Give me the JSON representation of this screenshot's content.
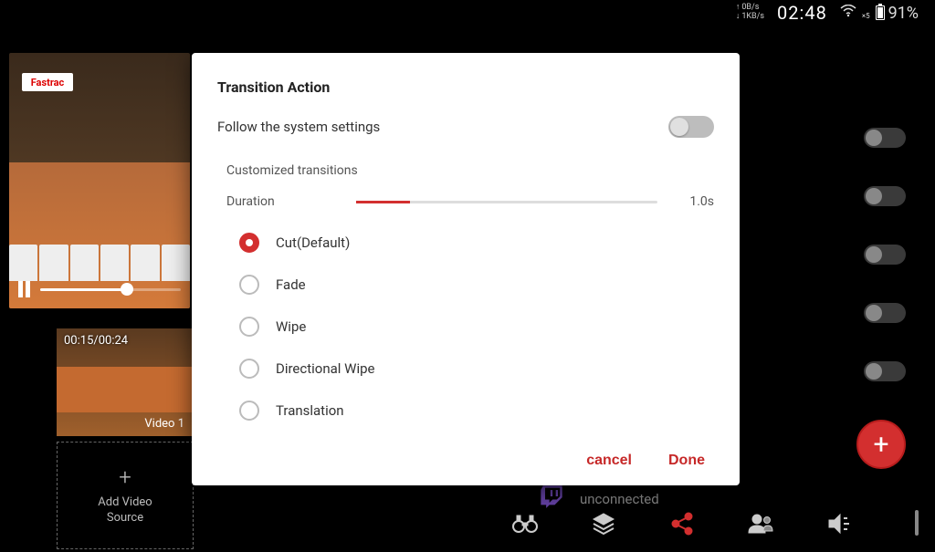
{
  "status": {
    "net_up": "0B/s",
    "net_down": "1KB/s",
    "time": "02:48",
    "wifi_sub": "×5",
    "battery_pct": "91%"
  },
  "preview": {
    "banner": "Fastrac",
    "progress_percent": 62
  },
  "sources": {
    "thumb_time": "00:15/00:24",
    "thumb_label": "Video 1",
    "add_label": "Add Video\nSource"
  },
  "connection": {
    "status": "unconnected"
  },
  "modal": {
    "title": "Transition Action",
    "follow_label": "Follow the system settings",
    "follow_enabled": false,
    "section": "Customized transitions",
    "duration_label": "Duration",
    "duration_value": "1.0s",
    "options": [
      {
        "label": "Cut(Default)",
        "selected": true
      },
      {
        "label": "Fade",
        "selected": false
      },
      {
        "label": "Wipe",
        "selected": false
      },
      {
        "label": "Directional Wipe",
        "selected": false
      },
      {
        "label": "Translation",
        "selected": false
      }
    ],
    "cancel": "cancel",
    "done": "Done"
  }
}
